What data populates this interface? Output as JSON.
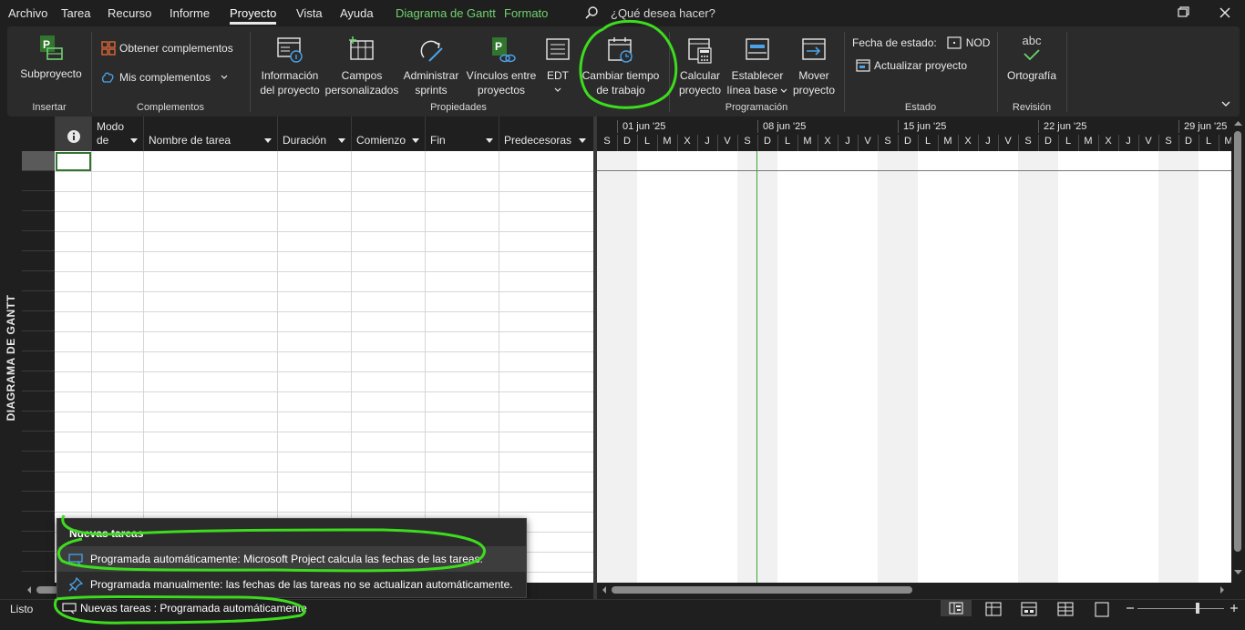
{
  "menu": {
    "tabs": [
      "Archivo",
      "Tarea",
      "Recurso",
      "Informe",
      "Proyecto",
      "Vista",
      "Ayuda"
    ],
    "active_tab": "Proyecto",
    "context_tabs": [
      "Diagrama de Gantt",
      "Formato"
    ],
    "search_placeholder": "¿Qué desea hacer?"
  },
  "ribbon": {
    "insertar": {
      "label": "Insertar",
      "subproyecto": "Subproyecto"
    },
    "complementos": {
      "label": "Complementos",
      "obtener": "Obtener complementos",
      "mis": "Mis complementos"
    },
    "propiedades": {
      "label": "Propiedades",
      "informacion": [
        "Información",
        "del proyecto"
      ],
      "campos": [
        "Campos",
        "personalizados"
      ],
      "sprints": [
        "Administrar",
        "sprints"
      ],
      "vinculos": [
        "Vínculos entre",
        "proyectos"
      ],
      "edt": "EDT",
      "cambiar": [
        "Cambiar tiempo",
        "de trabajo"
      ]
    },
    "programacion": {
      "label": "Programación",
      "calcular": [
        "Calcular",
        "proyecto"
      ],
      "establecer": [
        "Establecer",
        "línea base"
      ],
      "mover": [
        "Mover",
        "proyecto"
      ]
    },
    "estado": {
      "label": "Estado",
      "fecha_label": "Fecha de estado:",
      "fecha_value": "NOD",
      "actualizar": "Actualizar proyecto"
    },
    "revision": {
      "label": "Revisión",
      "abc": "abc",
      "ortografia": "Ortografía"
    }
  },
  "view_bar_label": "DIAGRAMA DE GANTT",
  "table": {
    "columns": [
      {
        "title_top": "Modo",
        "title": "de"
      },
      {
        "title": "Nombre de tarea"
      },
      {
        "title": "Duración"
      },
      {
        "title": "Comienzo"
      },
      {
        "title": "Fin"
      },
      {
        "title": "Predecesoras"
      }
    ],
    "rows": []
  },
  "timescale": {
    "weeks": [
      "01 jun '25",
      "08 jun '25",
      "15 jun '25",
      "22 jun '25",
      "29 jun '25"
    ],
    "days": [
      "S",
      "D",
      "L",
      "M",
      "X",
      "J",
      "V",
      "S",
      "D",
      "L",
      "M",
      "X",
      "J",
      "V",
      "S",
      "D",
      "L",
      "M",
      "X",
      "J",
      "V",
      "S",
      "D",
      "L",
      "M",
      "X",
      "J",
      "V",
      "S",
      "D",
      "L",
      "M"
    ]
  },
  "popup": {
    "title": "Nuevas tareas",
    "items": [
      "Programada automáticamente: Microsoft Project calcula las fechas de las tareas.",
      "Programada manualmente: las fechas de las tareas no se actualizan automáticamente."
    ]
  },
  "status": {
    "ready": "Listo",
    "new_tasks": "Nuevas tareas : Programada automáticamente"
  },
  "colors": {
    "accent_green": "#3ddc1e",
    "project_green": "#31752f"
  }
}
